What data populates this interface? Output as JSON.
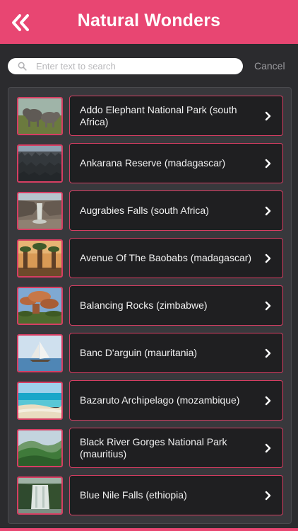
{
  "header": {
    "title": "Natural Wonders",
    "back_icon": "double-chevron-left-icon"
  },
  "search": {
    "placeholder": "Enter text to search",
    "value": "",
    "cancel_label": "Cancel"
  },
  "colors": {
    "accent": "#e84672",
    "background": "#2b2b2e",
    "card": "#1f1f21"
  },
  "items": [
    {
      "label": "Addo Elephant National Park (south Africa)",
      "thumb": "elephants"
    },
    {
      "label": "Ankarana Reserve (madagascar)",
      "thumb": "rock-forest"
    },
    {
      "label": "Augrabies Falls (south Africa)",
      "thumb": "waterfall-canyon"
    },
    {
      "label": "Avenue Of The Baobabs (madagascar)",
      "thumb": "baobab-trees"
    },
    {
      "label": "Balancing Rocks (zimbabwe)",
      "thumb": "balancing-rocks"
    },
    {
      "label": "Banc D'arguin (mauritania)",
      "thumb": "sailboat"
    },
    {
      "label": "Bazaruto Archipelago (mozambique)",
      "thumb": "beach"
    },
    {
      "label": "Black River Gorges National Park (mauritius)",
      "thumb": "green-hills"
    },
    {
      "label": "Blue Nile Falls (ethiopia)",
      "thumb": "waterfall"
    }
  ]
}
